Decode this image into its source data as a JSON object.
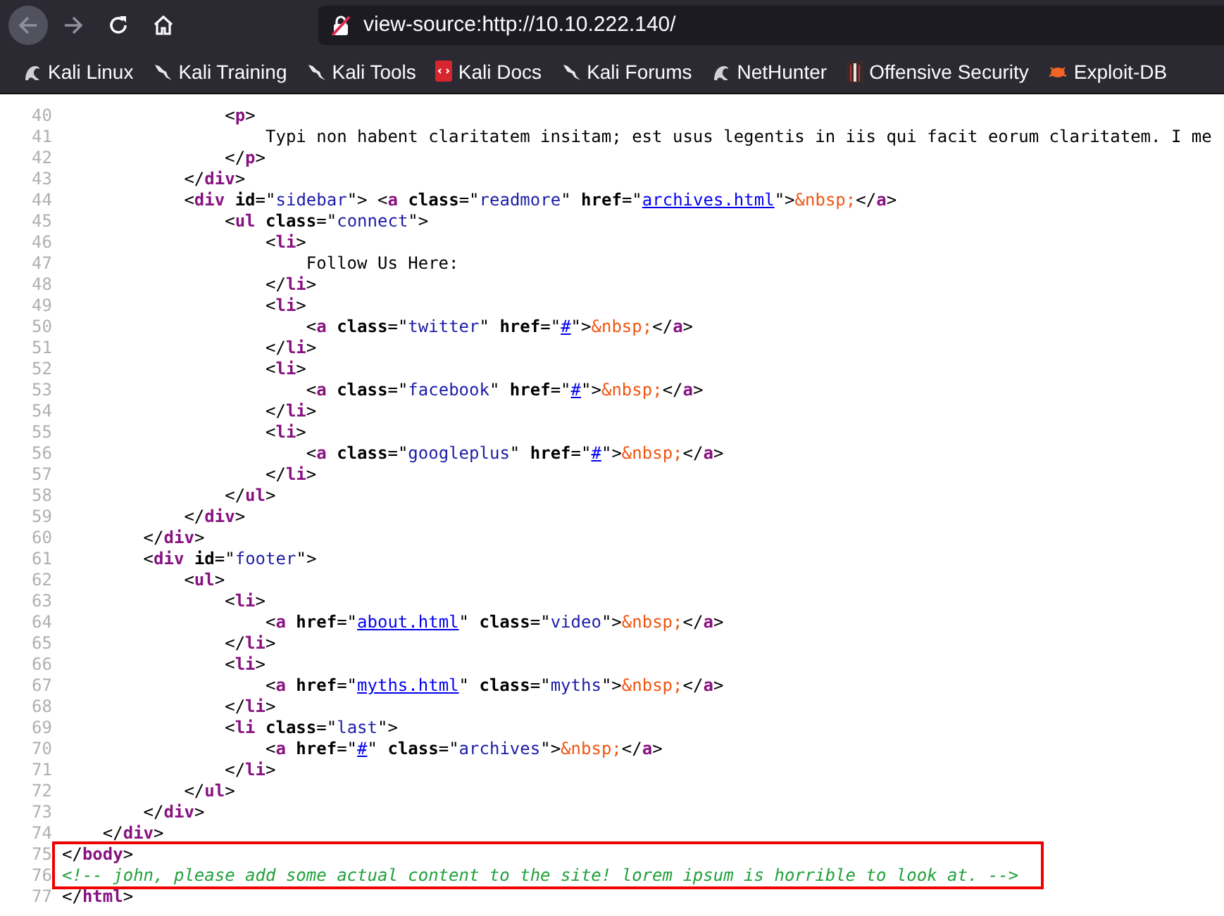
{
  "toolbar": {
    "url": "view-source:http://10.10.222.140/"
  },
  "bookmarks": [
    {
      "label": "Kali Linux",
      "kind": "dragon"
    },
    {
      "label": "Kali Training",
      "kind": "blade"
    },
    {
      "label": "Kali Tools",
      "kind": "blade"
    },
    {
      "label": "Kali Docs",
      "kind": "doc"
    },
    {
      "label": "Kali Forums",
      "kind": "blade"
    },
    {
      "label": "NetHunter",
      "kind": "dragon"
    },
    {
      "label": "Offensive Security",
      "kind": "figure"
    },
    {
      "label": "Exploit-DB",
      "kind": "bug"
    }
  ],
  "lines": [
    {
      "n": "40",
      "highlighted": false,
      "tokens": [
        {
          "kind": "p",
          "t": "                <"
        },
        {
          "kind": "tag",
          "t": "p"
        },
        {
          "kind": "p",
          "t": ">"
        }
      ]
    },
    {
      "n": "41",
      "highlighted": false,
      "tokens": [
        {
          "kind": "text",
          "t": "                    Typi non habent claritatem insitam; est usus legentis in iis qui facit eorum claritatem. I me"
        }
      ]
    },
    {
      "n": "42",
      "highlighted": false,
      "tokens": [
        {
          "kind": "p",
          "t": "                </"
        },
        {
          "kind": "tag",
          "t": "p"
        },
        {
          "kind": "p",
          "t": ">"
        }
      ]
    },
    {
      "n": "43",
      "highlighted": false,
      "tokens": [
        {
          "kind": "p",
          "t": "            </"
        },
        {
          "kind": "tag",
          "t": "div"
        },
        {
          "kind": "p",
          "t": ">"
        }
      ]
    },
    {
      "n": "44",
      "highlighted": false,
      "tokens": [
        {
          "kind": "p",
          "t": "            <"
        },
        {
          "kind": "tag",
          "t": "div"
        },
        {
          "kind": "attr",
          "t": " id"
        },
        {
          "kind": "p",
          "t": "=\""
        },
        {
          "kind": "val",
          "t": "sidebar"
        },
        {
          "kind": "p",
          "t": "\"> <"
        },
        {
          "kind": "tag",
          "t": "a"
        },
        {
          "kind": "attr",
          "t": " class"
        },
        {
          "kind": "p",
          "t": "=\""
        },
        {
          "kind": "val",
          "t": "readmore"
        },
        {
          "kind": "p",
          "t": "\" "
        },
        {
          "kind": "attr",
          "t": "href"
        },
        {
          "kind": "p",
          "t": "=\""
        },
        {
          "kind": "link",
          "t": "archives.html"
        },
        {
          "kind": "p",
          "t": "\">"
        },
        {
          "kind": "ent",
          "t": "&nbsp;"
        },
        {
          "kind": "p",
          "t": "</"
        },
        {
          "kind": "tag",
          "t": "a"
        },
        {
          "kind": "p",
          "t": ">"
        }
      ]
    },
    {
      "n": "45",
      "highlighted": false,
      "tokens": [
        {
          "kind": "p",
          "t": "                <"
        },
        {
          "kind": "tag",
          "t": "ul"
        },
        {
          "kind": "attr",
          "t": " class"
        },
        {
          "kind": "p",
          "t": "=\""
        },
        {
          "kind": "val",
          "t": "connect"
        },
        {
          "kind": "p",
          "t": "\">"
        }
      ]
    },
    {
      "n": "46",
      "highlighted": false,
      "tokens": [
        {
          "kind": "p",
          "t": "                    <"
        },
        {
          "kind": "tag",
          "t": "li"
        },
        {
          "kind": "p",
          "t": ">"
        }
      ]
    },
    {
      "n": "47",
      "highlighted": false,
      "tokens": [
        {
          "kind": "text",
          "t": "                        Follow Us Here:"
        }
      ]
    },
    {
      "n": "48",
      "highlighted": false,
      "tokens": [
        {
          "kind": "p",
          "t": "                    </"
        },
        {
          "kind": "tag",
          "t": "li"
        },
        {
          "kind": "p",
          "t": ">"
        }
      ]
    },
    {
      "n": "49",
      "highlighted": false,
      "tokens": [
        {
          "kind": "p",
          "t": "                    <"
        },
        {
          "kind": "tag",
          "t": "li"
        },
        {
          "kind": "p",
          "t": ">"
        }
      ]
    },
    {
      "n": "50",
      "highlighted": false,
      "tokens": [
        {
          "kind": "p",
          "t": "                        <"
        },
        {
          "kind": "tag",
          "t": "a"
        },
        {
          "kind": "attr",
          "t": " class"
        },
        {
          "kind": "p",
          "t": "=\""
        },
        {
          "kind": "val",
          "t": "twitter"
        },
        {
          "kind": "p",
          "t": "\" "
        },
        {
          "kind": "attr",
          "t": "href"
        },
        {
          "kind": "p",
          "t": "=\""
        },
        {
          "kind": "link",
          "t": "#"
        },
        {
          "kind": "p",
          "t": "\">"
        },
        {
          "kind": "ent",
          "t": "&nbsp;"
        },
        {
          "kind": "p",
          "t": "</"
        },
        {
          "kind": "tag",
          "t": "a"
        },
        {
          "kind": "p",
          "t": ">"
        }
      ]
    },
    {
      "n": "51",
      "highlighted": false,
      "tokens": [
        {
          "kind": "p",
          "t": "                    </"
        },
        {
          "kind": "tag",
          "t": "li"
        },
        {
          "kind": "p",
          "t": ">"
        }
      ]
    },
    {
      "n": "52",
      "highlighted": false,
      "tokens": [
        {
          "kind": "p",
          "t": "                    <"
        },
        {
          "kind": "tag",
          "t": "li"
        },
        {
          "kind": "p",
          "t": ">"
        }
      ]
    },
    {
      "n": "53",
      "highlighted": false,
      "tokens": [
        {
          "kind": "p",
          "t": "                        <"
        },
        {
          "kind": "tag",
          "t": "a"
        },
        {
          "kind": "attr",
          "t": " class"
        },
        {
          "kind": "p",
          "t": "=\""
        },
        {
          "kind": "val",
          "t": "facebook"
        },
        {
          "kind": "p",
          "t": "\" "
        },
        {
          "kind": "attr",
          "t": "href"
        },
        {
          "kind": "p",
          "t": "=\""
        },
        {
          "kind": "link",
          "t": "#"
        },
        {
          "kind": "p",
          "t": "\">"
        },
        {
          "kind": "ent",
          "t": "&nbsp;"
        },
        {
          "kind": "p",
          "t": "</"
        },
        {
          "kind": "tag",
          "t": "a"
        },
        {
          "kind": "p",
          "t": ">"
        }
      ]
    },
    {
      "n": "54",
      "highlighted": false,
      "tokens": [
        {
          "kind": "p",
          "t": "                    </"
        },
        {
          "kind": "tag",
          "t": "li"
        },
        {
          "kind": "p",
          "t": ">"
        }
      ]
    },
    {
      "n": "55",
      "highlighted": false,
      "tokens": [
        {
          "kind": "p",
          "t": "                    <"
        },
        {
          "kind": "tag",
          "t": "li"
        },
        {
          "kind": "p",
          "t": ">"
        }
      ]
    },
    {
      "n": "56",
      "highlighted": false,
      "tokens": [
        {
          "kind": "p",
          "t": "                        <"
        },
        {
          "kind": "tag",
          "t": "a"
        },
        {
          "kind": "attr",
          "t": " class"
        },
        {
          "kind": "p",
          "t": "=\""
        },
        {
          "kind": "val",
          "t": "googleplus"
        },
        {
          "kind": "p",
          "t": "\" "
        },
        {
          "kind": "attr",
          "t": "href"
        },
        {
          "kind": "p",
          "t": "=\""
        },
        {
          "kind": "link",
          "t": "#"
        },
        {
          "kind": "p",
          "t": "\">"
        },
        {
          "kind": "ent",
          "t": "&nbsp;"
        },
        {
          "kind": "p",
          "t": "</"
        },
        {
          "kind": "tag",
          "t": "a"
        },
        {
          "kind": "p",
          "t": ">"
        }
      ]
    },
    {
      "n": "57",
      "highlighted": false,
      "tokens": [
        {
          "kind": "p",
          "t": "                    </"
        },
        {
          "kind": "tag",
          "t": "li"
        },
        {
          "kind": "p",
          "t": ">"
        }
      ]
    },
    {
      "n": "58",
      "highlighted": false,
      "tokens": [
        {
          "kind": "p",
          "t": "                </"
        },
        {
          "kind": "tag",
          "t": "ul"
        },
        {
          "kind": "p",
          "t": ">"
        }
      ]
    },
    {
      "n": "59",
      "highlighted": false,
      "tokens": [
        {
          "kind": "p",
          "t": "            </"
        },
        {
          "kind": "tag",
          "t": "div"
        },
        {
          "kind": "p",
          "t": ">"
        }
      ]
    },
    {
      "n": "60",
      "highlighted": false,
      "tokens": [
        {
          "kind": "p",
          "t": "        </"
        },
        {
          "kind": "tag",
          "t": "div"
        },
        {
          "kind": "p",
          "t": ">"
        }
      ]
    },
    {
      "n": "61",
      "highlighted": false,
      "tokens": [
        {
          "kind": "p",
          "t": "        <"
        },
        {
          "kind": "tag",
          "t": "div"
        },
        {
          "kind": "attr",
          "t": " id"
        },
        {
          "kind": "p",
          "t": "=\""
        },
        {
          "kind": "val",
          "t": "footer"
        },
        {
          "kind": "p",
          "t": "\">"
        }
      ]
    },
    {
      "n": "62",
      "highlighted": false,
      "tokens": [
        {
          "kind": "p",
          "t": "            <"
        },
        {
          "kind": "tag",
          "t": "ul"
        },
        {
          "kind": "p",
          "t": ">"
        }
      ]
    },
    {
      "n": "63",
      "highlighted": false,
      "tokens": [
        {
          "kind": "p",
          "t": "                <"
        },
        {
          "kind": "tag",
          "t": "li"
        },
        {
          "kind": "p",
          "t": ">"
        }
      ]
    },
    {
      "n": "64",
      "highlighted": false,
      "tokens": [
        {
          "kind": "p",
          "t": "                    <"
        },
        {
          "kind": "tag",
          "t": "a"
        },
        {
          "kind": "attr",
          "t": " href"
        },
        {
          "kind": "p",
          "t": "=\""
        },
        {
          "kind": "link",
          "t": "about.html"
        },
        {
          "kind": "p",
          "t": "\" "
        },
        {
          "kind": "attr",
          "t": "class"
        },
        {
          "kind": "p",
          "t": "=\""
        },
        {
          "kind": "val",
          "t": "video"
        },
        {
          "kind": "p",
          "t": "\">"
        },
        {
          "kind": "ent",
          "t": "&nbsp;"
        },
        {
          "kind": "p",
          "t": "</"
        },
        {
          "kind": "tag",
          "t": "a"
        },
        {
          "kind": "p",
          "t": ">"
        }
      ]
    },
    {
      "n": "65",
      "highlighted": false,
      "tokens": [
        {
          "kind": "p",
          "t": "                </"
        },
        {
          "kind": "tag",
          "t": "li"
        },
        {
          "kind": "p",
          "t": ">"
        }
      ]
    },
    {
      "n": "66",
      "highlighted": false,
      "tokens": [
        {
          "kind": "p",
          "t": "                <"
        },
        {
          "kind": "tag",
          "t": "li"
        },
        {
          "kind": "p",
          "t": ">"
        }
      ]
    },
    {
      "n": "67",
      "highlighted": false,
      "tokens": [
        {
          "kind": "p",
          "t": "                    <"
        },
        {
          "kind": "tag",
          "t": "a"
        },
        {
          "kind": "attr",
          "t": " href"
        },
        {
          "kind": "p",
          "t": "=\""
        },
        {
          "kind": "link",
          "t": "myths.html"
        },
        {
          "kind": "p",
          "t": "\" "
        },
        {
          "kind": "attr",
          "t": "class"
        },
        {
          "kind": "p",
          "t": "=\""
        },
        {
          "kind": "val",
          "t": "myths"
        },
        {
          "kind": "p",
          "t": "\">"
        },
        {
          "kind": "ent",
          "t": "&nbsp;"
        },
        {
          "kind": "p",
          "t": "</"
        },
        {
          "kind": "tag",
          "t": "a"
        },
        {
          "kind": "p",
          "t": ">"
        }
      ]
    },
    {
      "n": "68",
      "highlighted": false,
      "tokens": [
        {
          "kind": "p",
          "t": "                </"
        },
        {
          "kind": "tag",
          "t": "li"
        },
        {
          "kind": "p",
          "t": ">"
        }
      ]
    },
    {
      "n": "69",
      "highlighted": false,
      "tokens": [
        {
          "kind": "p",
          "t": "                <"
        },
        {
          "kind": "tag",
          "t": "li"
        },
        {
          "kind": "attr",
          "t": " class"
        },
        {
          "kind": "p",
          "t": "=\""
        },
        {
          "kind": "val",
          "t": "last"
        },
        {
          "kind": "p",
          "t": "\">"
        }
      ]
    },
    {
      "n": "70",
      "highlighted": false,
      "tokens": [
        {
          "kind": "p",
          "t": "                    <"
        },
        {
          "kind": "tag",
          "t": "a"
        },
        {
          "kind": "attr",
          "t": " href"
        },
        {
          "kind": "p",
          "t": "=\""
        },
        {
          "kind": "link",
          "t": "#"
        },
        {
          "kind": "p",
          "t": "\" "
        },
        {
          "kind": "attr",
          "t": "class"
        },
        {
          "kind": "p",
          "t": "=\""
        },
        {
          "kind": "val",
          "t": "archives"
        },
        {
          "kind": "p",
          "t": "\">"
        },
        {
          "kind": "ent",
          "t": "&nbsp;"
        },
        {
          "kind": "p",
          "t": "</"
        },
        {
          "kind": "tag",
          "t": "a"
        },
        {
          "kind": "p",
          "t": ">"
        }
      ]
    },
    {
      "n": "71",
      "highlighted": false,
      "tokens": [
        {
          "kind": "p",
          "t": "                </"
        },
        {
          "kind": "tag",
          "t": "li"
        },
        {
          "kind": "p",
          "t": ">"
        }
      ]
    },
    {
      "n": "72",
      "highlighted": false,
      "tokens": [
        {
          "kind": "p",
          "t": "            </"
        },
        {
          "kind": "tag",
          "t": "ul"
        },
        {
          "kind": "p",
          "t": ">"
        }
      ]
    },
    {
      "n": "73",
      "highlighted": false,
      "tokens": [
        {
          "kind": "p",
          "t": "        </"
        },
        {
          "kind": "tag",
          "t": "div"
        },
        {
          "kind": "p",
          "t": ">"
        }
      ]
    },
    {
      "n": "74",
      "highlighted": false,
      "tokens": [
        {
          "kind": "p",
          "t": "    </"
        },
        {
          "kind": "tag",
          "t": "div"
        },
        {
          "kind": "p",
          "t": ">"
        }
      ]
    },
    {
      "n": "75",
      "highlighted": true,
      "tokens": [
        {
          "kind": "p",
          "t": "</"
        },
        {
          "kind": "tag",
          "t": "body"
        },
        {
          "kind": "p",
          "t": ">"
        }
      ]
    },
    {
      "n": "76",
      "highlighted": true,
      "tokens": [
        {
          "kind": "comment",
          "t": "<!-- john, please add some actual content to the site! lorem ipsum is horrible to look at. -->"
        }
      ]
    },
    {
      "n": "77",
      "highlighted": false,
      "tokens": [
        {
          "kind": "p",
          "t": "</"
        },
        {
          "kind": "tag",
          "t": "html"
        },
        {
          "kind": "p",
          "t": ">"
        }
      ]
    }
  ]
}
